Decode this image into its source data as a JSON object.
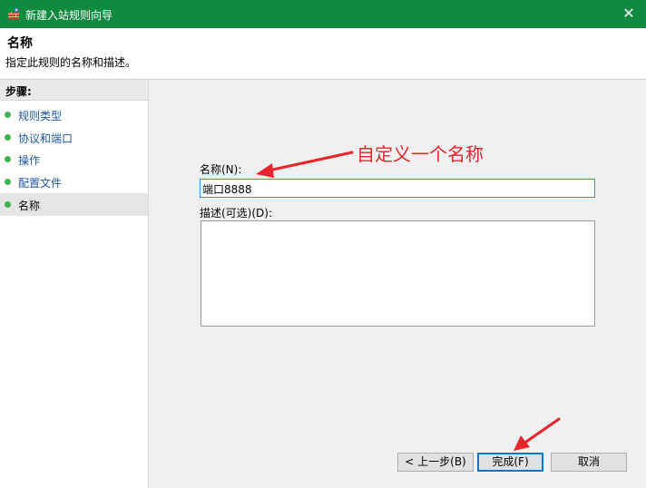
{
  "window": {
    "title": "新建入站规则向导",
    "close_glyph": "✕"
  },
  "header": {
    "title": "名称",
    "description": "指定此规则的名称和描述。"
  },
  "sidebar": {
    "heading": "步骤:",
    "items": [
      {
        "label": "规则类型"
      },
      {
        "label": "协议和端口"
      },
      {
        "label": "操作"
      },
      {
        "label": "配置文件"
      },
      {
        "label": "名称"
      }
    ]
  },
  "form": {
    "name_label": "名称(N):",
    "name_value": "端口8888",
    "desc_label": "描述(可选)(D):",
    "desc_value": ""
  },
  "buttons": {
    "back": "< 上一步(B)",
    "finish": "完成(F)",
    "cancel": "取消"
  },
  "annotation": {
    "text": "自定义一个名称",
    "color": "#e8242c"
  },
  "colors": {
    "titlebar": "#0f8a3e",
    "step_dot": "#3fb34f",
    "link": "#1e56a0",
    "focus": "#3d8be0"
  }
}
